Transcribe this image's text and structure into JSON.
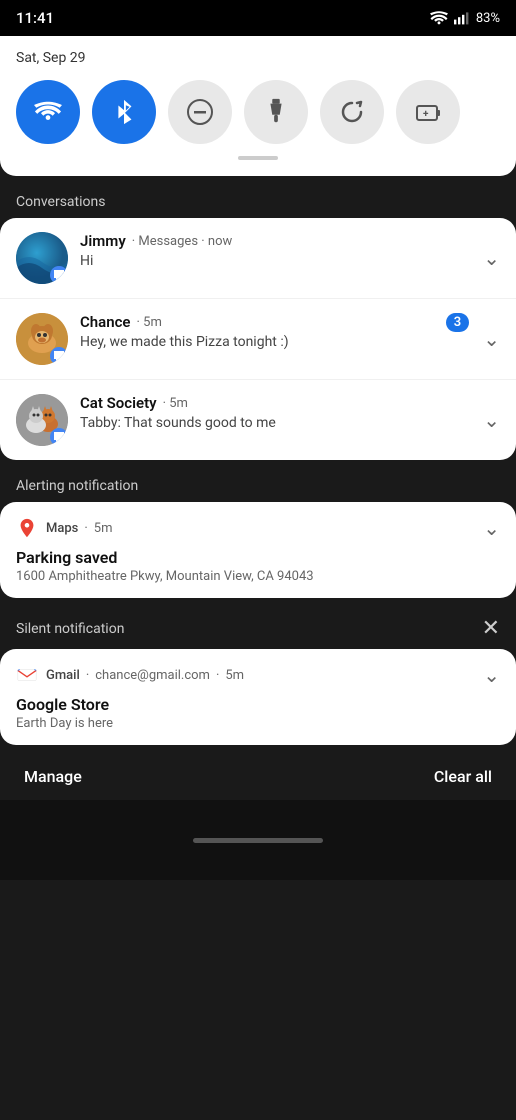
{
  "statusBar": {
    "time": "11:41",
    "battery": "83%"
  },
  "quickSettings": {
    "date": "Sat, Sep 29",
    "tiles": [
      {
        "id": "wifi",
        "label": "Wi-Fi",
        "active": true
      },
      {
        "id": "bluetooth",
        "label": "Bluetooth",
        "active": true
      },
      {
        "id": "dnd",
        "label": "Do Not Disturb",
        "active": false
      },
      {
        "id": "flashlight",
        "label": "Flashlight",
        "active": false
      },
      {
        "id": "autorotate",
        "label": "Auto Rotate",
        "active": false
      },
      {
        "id": "battery-saver",
        "label": "Battery Saver",
        "active": false
      }
    ]
  },
  "sections": {
    "conversations": "Conversations",
    "alerting": "Alerting notification",
    "silent": "Silent notification"
  },
  "conversations": [
    {
      "id": "jimmy",
      "name": "Jimmy",
      "app": "Messages",
      "time": "now",
      "message": "Hi",
      "badge": null
    },
    {
      "id": "chance",
      "name": "Chance",
      "app": null,
      "time": "5m",
      "message": "Hey, we made this Pizza tonight :)",
      "badge": "3"
    },
    {
      "id": "catSociety",
      "name": "Cat Society",
      "app": null,
      "time": "5m",
      "message": "Tabby: That sounds good to me",
      "badge": null
    }
  ],
  "mapsNotification": {
    "app": "Maps",
    "time": "5m",
    "title": "Parking saved",
    "address": "1600 Amphitheatre Pkwy, Mountain View, CA 94043"
  },
  "gmailNotification": {
    "app": "Gmail",
    "email": "chance@gmail.com",
    "time": "5m",
    "title": "Google Store",
    "subtitle": "Earth Day is here"
  },
  "bottomBar": {
    "manage": "Manage",
    "clearAll": "Clear all"
  }
}
